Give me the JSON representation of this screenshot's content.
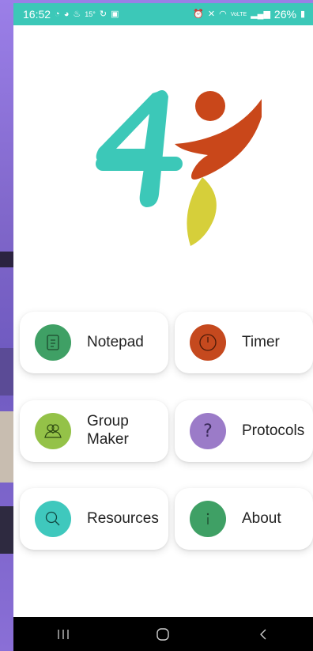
{
  "status_bar": {
    "time": "16:52",
    "temp": "15°",
    "battery": "26%",
    "network": "VoLTE",
    "left_icons": [
      "sync-icon",
      "messenger-icon",
      "fire-icon",
      "temperature-text",
      "refresh-icon",
      "gallery-icon"
    ],
    "right_icons": [
      "alarm-icon",
      "mute-icon",
      "wifi-icon",
      "signal-icon",
      "battery-icon"
    ]
  },
  "logo": {
    "text": "4",
    "colors": {
      "four": "#3cc8b8",
      "flame": "#c9471a",
      "leaf": "#d6cf3a",
      "dot": "#c9471a"
    }
  },
  "menu": {
    "notepad": {
      "label": "Notepad",
      "icon": "notepad-icon",
      "color": "#3fa065"
    },
    "timer": {
      "label": "Timer",
      "icon": "timer-icon",
      "color": "#c5491e"
    },
    "group_maker": {
      "label_line1": "Group",
      "label_line2": "Maker",
      "icon": "group-icon",
      "color": "#94c248"
    },
    "protocols": {
      "label": "Protocols",
      "icon": "question-icon",
      "color": "#9b7bc8"
    },
    "resources": {
      "label": "Resources",
      "icon": "search-icon",
      "color": "#3fc8bd"
    },
    "about": {
      "label": "About",
      "icon": "info-icon",
      "color": "#3fa065"
    }
  },
  "nav_bar": {
    "buttons": [
      "recents-icon",
      "home-icon",
      "back-icon"
    ]
  },
  "colors": {
    "status_bar": "#3cc8b8",
    "card_bg": "#ffffff",
    "nav_bar": "#000000"
  }
}
